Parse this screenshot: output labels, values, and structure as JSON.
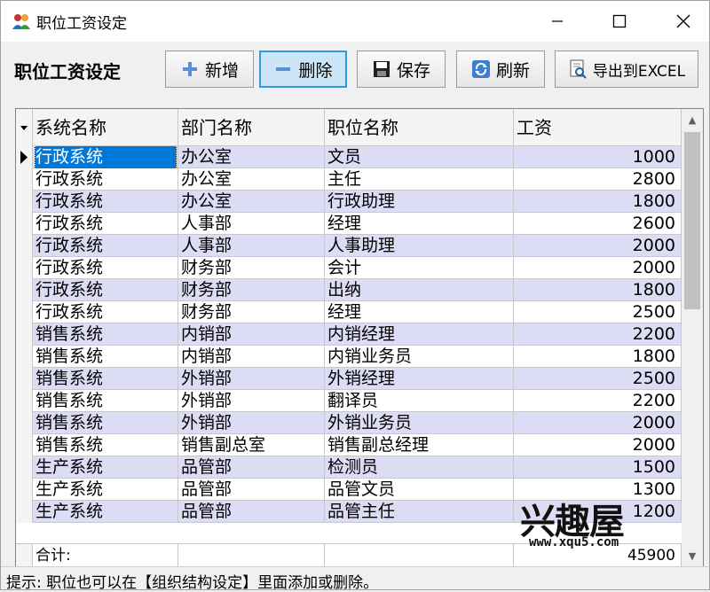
{
  "window": {
    "title": "职位工资设定",
    "min_icon": "minimize-icon",
    "max_icon": "maximize-icon",
    "close_icon": "close-icon"
  },
  "toolbar": {
    "title": "职位工资设定",
    "buttons": [
      {
        "label": "新增",
        "icon": "plus-icon"
      },
      {
        "label": "删除",
        "icon": "minus-icon"
      },
      {
        "label": "保存",
        "icon": "save-icon"
      },
      {
        "label": "刷新",
        "icon": "refresh-icon"
      },
      {
        "label": "导出到EXCEL",
        "icon": "export-icon"
      }
    ]
  },
  "grid": {
    "columns": [
      "系统名称",
      "部门名称",
      "职位名称",
      "工资"
    ],
    "rows": [
      {
        "system": "行政系统",
        "dept": "办公室",
        "position": "文员",
        "salary": "1000"
      },
      {
        "system": "行政系统",
        "dept": "办公室",
        "position": "主任",
        "salary": "2800"
      },
      {
        "system": "行政系统",
        "dept": "办公室",
        "position": "行政助理",
        "salary": "1800"
      },
      {
        "system": "行政系统",
        "dept": "人事部",
        "position": "经理",
        "salary": "2600"
      },
      {
        "system": "行政系统",
        "dept": "人事部",
        "position": "人事助理",
        "salary": "2000"
      },
      {
        "system": "行政系统",
        "dept": "财务部",
        "position": "会计",
        "salary": "2000"
      },
      {
        "system": "行政系统",
        "dept": "财务部",
        "position": "出纳",
        "salary": "1800"
      },
      {
        "system": "行政系统",
        "dept": "财务部",
        "position": "经理",
        "salary": "2500"
      },
      {
        "system": "销售系统",
        "dept": "内销部",
        "position": "内销经理",
        "salary": "2200"
      },
      {
        "system": "销售系统",
        "dept": "内销部",
        "position": "内销业务员",
        "salary": "1800"
      },
      {
        "system": "销售系统",
        "dept": "外销部",
        "position": "外销经理",
        "salary": "2500"
      },
      {
        "system": "销售系统",
        "dept": "外销部",
        "position": "翻译员",
        "salary": "2200"
      },
      {
        "system": "销售系统",
        "dept": "外销部",
        "position": "外销业务员",
        "salary": "2000"
      },
      {
        "system": "销售系统",
        "dept": "销售副总室",
        "position": "销售副总经理",
        "salary": "2000"
      },
      {
        "system": "生产系统",
        "dept": "品管部",
        "position": "检测员",
        "salary": "1500"
      },
      {
        "system": "生产系统",
        "dept": "品管部",
        "position": "品管文员",
        "salary": "1300"
      },
      {
        "system": "生产系统",
        "dept": "品管部",
        "position": "品管主任",
        "salary": "1200"
      }
    ],
    "footer_label": "合计:",
    "footer_total": "45900"
  },
  "status": {
    "text": "提示: 职位也可以在【组织结构设定】里面添加或删除。"
  },
  "watermark": {
    "text": "兴趣屋",
    "url": "www.xqu5.com"
  }
}
